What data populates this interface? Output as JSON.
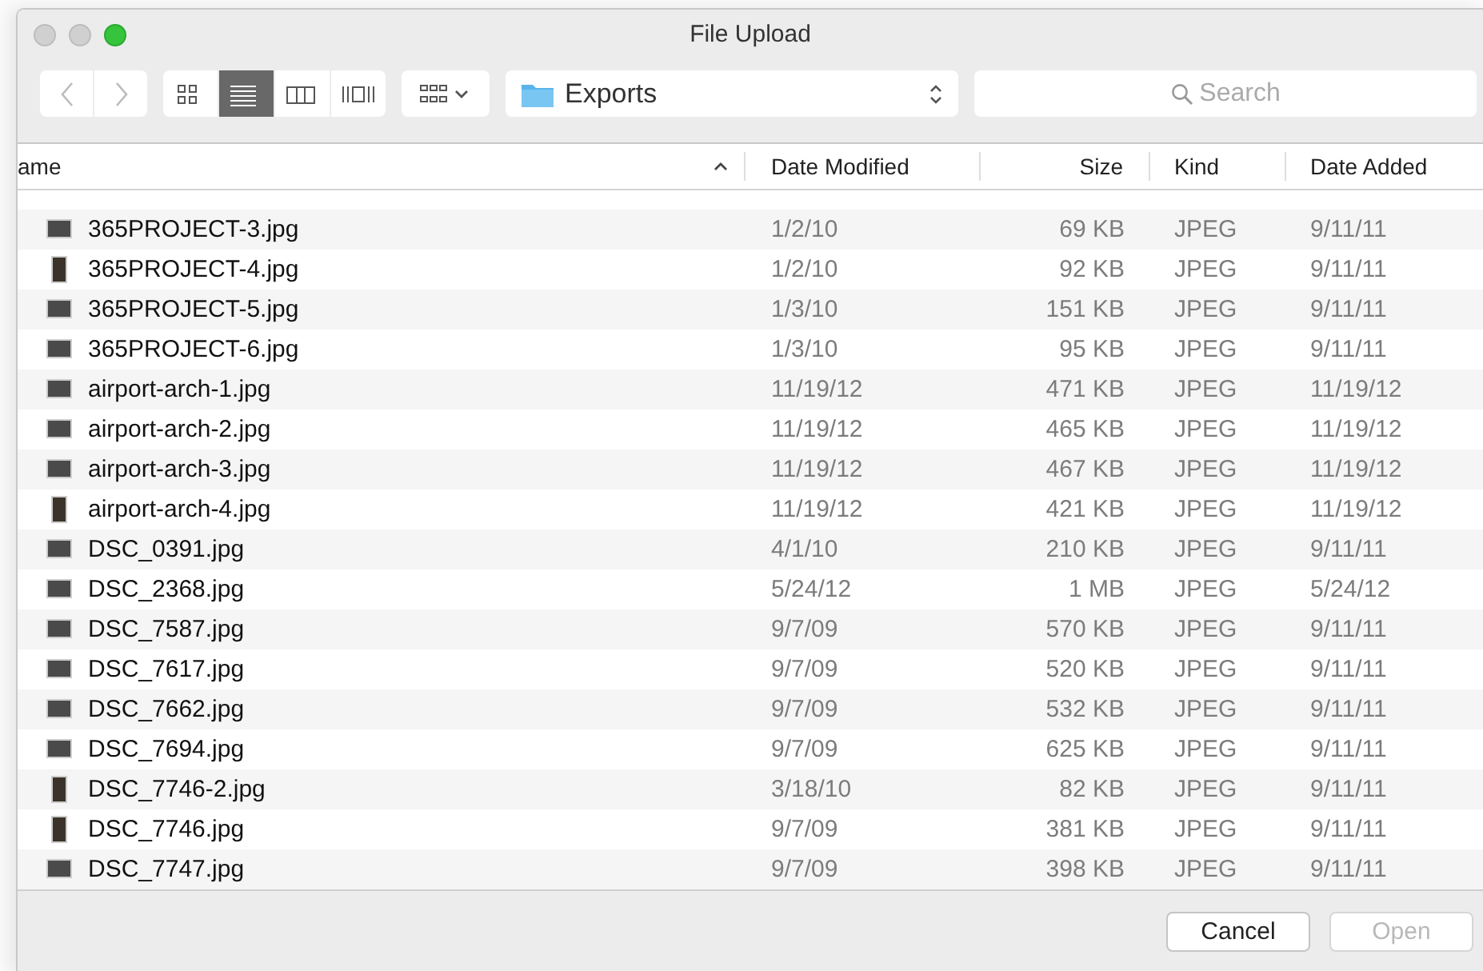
{
  "window": {
    "title": "File Upload"
  },
  "view_buttons": [
    {
      "kind": "icons",
      "selected": false
    },
    {
      "kind": "list",
      "selected": true
    },
    {
      "kind": "columns",
      "selected": false
    },
    {
      "kind": "coverflow",
      "selected": false
    }
  ],
  "location": {
    "folder": "Exports"
  },
  "search": {
    "placeholder": "Search"
  },
  "table": {
    "columns": [
      {
        "label": "ame",
        "sorted": true
      },
      {
        "label": "Date Modified",
        "sorted": false
      },
      {
        "label": "Size",
        "sorted": false
      },
      {
        "label": "Kind",
        "sorted": false
      },
      {
        "label": "Date Added",
        "sorted": false
      }
    ],
    "rows": [
      {
        "name": "365PROJECT-3.jpg",
        "modified": "1/2/10",
        "size": "69 KB",
        "kind": "JPEG",
        "added": "9/11/11",
        "portrait": false
      },
      {
        "name": "365PROJECT-4.jpg",
        "modified": "1/2/10",
        "size": "92 KB",
        "kind": "JPEG",
        "added": "9/11/11",
        "portrait": true
      },
      {
        "name": "365PROJECT-5.jpg",
        "modified": "1/3/10",
        "size": "151 KB",
        "kind": "JPEG",
        "added": "9/11/11",
        "portrait": false
      },
      {
        "name": "365PROJECT-6.jpg",
        "modified": "1/3/10",
        "size": "95 KB",
        "kind": "JPEG",
        "added": "9/11/11",
        "portrait": false
      },
      {
        "name": "airport-arch-1.jpg",
        "modified": "11/19/12",
        "size": "471 KB",
        "kind": "JPEG",
        "added": "11/19/12",
        "portrait": false
      },
      {
        "name": "airport-arch-2.jpg",
        "modified": "11/19/12",
        "size": "465 KB",
        "kind": "JPEG",
        "added": "11/19/12",
        "portrait": false
      },
      {
        "name": "airport-arch-3.jpg",
        "modified": "11/19/12",
        "size": "467 KB",
        "kind": "JPEG",
        "added": "11/19/12",
        "portrait": false
      },
      {
        "name": "airport-arch-4.jpg",
        "modified": "11/19/12",
        "size": "421 KB",
        "kind": "JPEG",
        "added": "11/19/12",
        "portrait": true
      },
      {
        "name": "DSC_0391.jpg",
        "modified": "4/1/10",
        "size": "210 KB",
        "kind": "JPEG",
        "added": "9/11/11",
        "portrait": false
      },
      {
        "name": "DSC_2368.jpg",
        "modified": "5/24/12",
        "size": "1 MB",
        "kind": "JPEG",
        "added": "5/24/12",
        "portrait": false
      },
      {
        "name": "DSC_7587.jpg",
        "modified": "9/7/09",
        "size": "570 KB",
        "kind": "JPEG",
        "added": "9/11/11",
        "portrait": false
      },
      {
        "name": "DSC_7617.jpg",
        "modified": "9/7/09",
        "size": "520 KB",
        "kind": "JPEG",
        "added": "9/11/11",
        "portrait": false
      },
      {
        "name": "DSC_7662.jpg",
        "modified": "9/7/09",
        "size": "532 KB",
        "kind": "JPEG",
        "added": "9/11/11",
        "portrait": false
      },
      {
        "name": "DSC_7694.jpg",
        "modified": "9/7/09",
        "size": "625 KB",
        "kind": "JPEG",
        "added": "9/11/11",
        "portrait": false
      },
      {
        "name": "DSC_7746-2.jpg",
        "modified": "3/18/10",
        "size": "82 KB",
        "kind": "JPEG",
        "added": "9/11/11",
        "portrait": true
      },
      {
        "name": "DSC_7746.jpg",
        "modified": "9/7/09",
        "size": "381 KB",
        "kind": "JPEG",
        "added": "9/11/11",
        "portrait": true
      },
      {
        "name": "DSC_7747.jpg",
        "modified": "9/7/09",
        "size": "398 KB",
        "kind": "JPEG",
        "added": "9/11/11",
        "portrait": false
      }
    ]
  },
  "buttons": [
    {
      "label": "Cancel",
      "disabled": false
    },
    {
      "label": "Open",
      "disabled": true
    }
  ]
}
